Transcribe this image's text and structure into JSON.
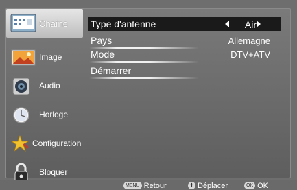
{
  "sidebar": {
    "items": [
      {
        "label": "Chaîne",
        "icon": "channel-icon",
        "active": true
      },
      {
        "label": "Image",
        "icon": "picture-icon",
        "active": false
      },
      {
        "label": "Audio",
        "icon": "speaker-icon",
        "active": false
      },
      {
        "label": "Horloge",
        "icon": "clock-icon",
        "active": false
      },
      {
        "label": "Configuration",
        "icon": "star-settings-icon",
        "active": false
      },
      {
        "label": "Bloquer",
        "icon": "lock-icon",
        "active": false
      }
    ]
  },
  "main": {
    "rows": [
      {
        "label": "Type d'antenne",
        "value": "Air",
        "selected": true
      },
      {
        "label": "Pays",
        "value": "Allemagne",
        "selected": false
      },
      {
        "label": "Mode",
        "value": "DTV+ATV",
        "selected": false
      },
      {
        "label": "Démarrer",
        "value": "",
        "selected": false
      }
    ]
  },
  "footer": {
    "menu_key": "MENU",
    "menu_label": "Retour",
    "move_key": "+",
    "move_label": "Déplacer",
    "ok_key": "OK",
    "ok_label": "OK"
  },
  "colors": {
    "background": "#6e6e6e",
    "selected_row": "#1a1a1a",
    "active_tab": "#d9d9d9",
    "text": "#ffffff"
  }
}
